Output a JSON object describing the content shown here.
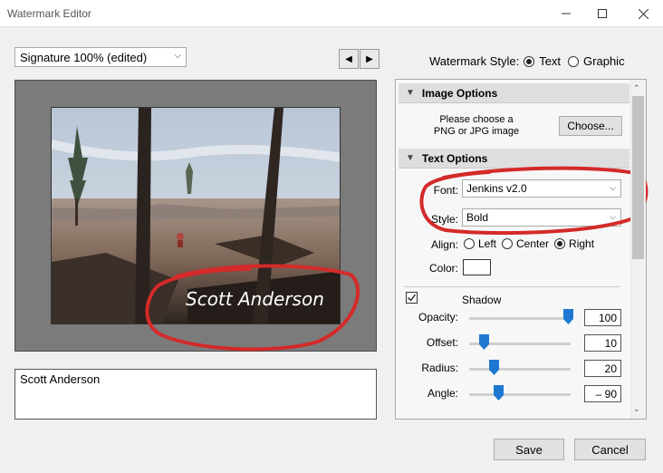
{
  "window": {
    "title": "Watermark Editor"
  },
  "preset": {
    "value": "Signature 100% (edited)"
  },
  "watermark_style": {
    "label": "Watermark Style:",
    "options": [
      "Text",
      "Graphic"
    ],
    "selected": "Text"
  },
  "preview": {
    "watermark_text": "Scott Anderson",
    "annotation_color": "#d42a2a"
  },
  "text_input": {
    "value": "Scott Anderson"
  },
  "image_options": {
    "title": "Image Options",
    "prompt_line1": "Please choose a",
    "prompt_line2": "PNG or JPG image",
    "choose_label": "Choose..."
  },
  "text_options": {
    "title": "Text Options",
    "font_label": "Font:",
    "font_value": "Jenkins v2.0",
    "style_label": "Style:",
    "style_value": "Bold",
    "align_label": "Align:",
    "align_options": [
      "Left",
      "Center",
      "Right"
    ],
    "align_selected": "Right",
    "color_label": "Color:",
    "color_value": "#ffffff"
  },
  "shadow": {
    "label": "Shadow",
    "checked": true,
    "opacity_label": "Opacity:",
    "opacity_value": "100",
    "offset_label": "Offset:",
    "offset_value": "10",
    "radius_label": "Radius:",
    "radius_value": "20",
    "angle_label": "Angle:",
    "angle_value": "– 90"
  },
  "footer": {
    "save_label": "Save",
    "cancel_label": "Cancel"
  }
}
